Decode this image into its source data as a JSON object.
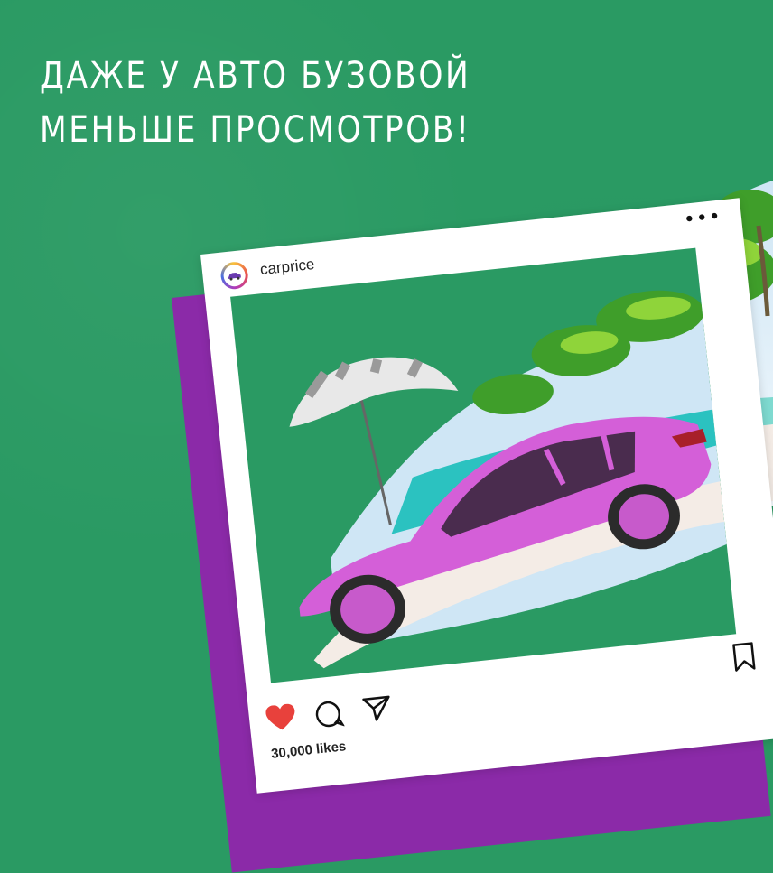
{
  "headline": {
    "line1": "ДАЖЕ У АВТО БУЗОВОЙ",
    "line2": "МЕНЬШЕ ПРОСМОТРОВ!"
  },
  "post": {
    "username": "carprice",
    "likes": "30,000 likes",
    "menu_icon": "more-dots-icon",
    "icons": [
      "heart-icon",
      "comment-icon",
      "share-icon",
      "bookmark-icon"
    ],
    "liked": true
  },
  "colors": {
    "background": "#2a9a63",
    "accent_purple": "#8b2aa8",
    "car": "#d45fd8",
    "heart": "#e8413c"
  }
}
